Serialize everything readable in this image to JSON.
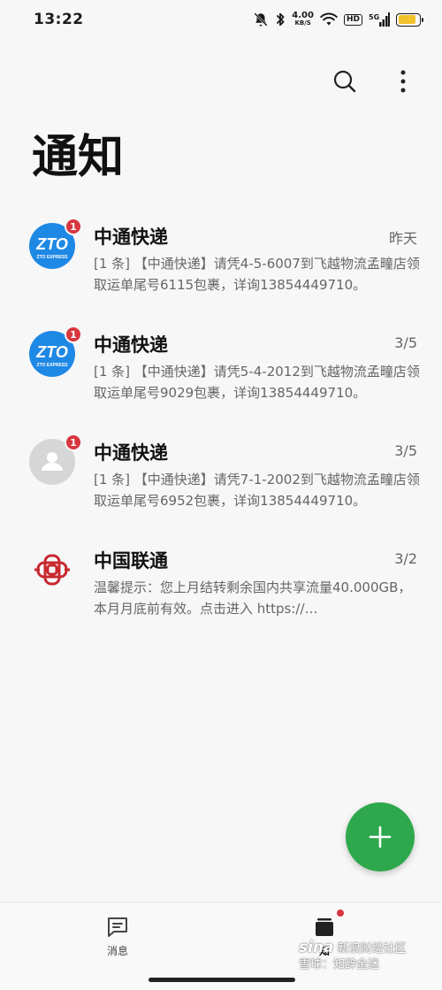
{
  "status_bar": {
    "time": "13:22",
    "net_speed": "4.00",
    "net_unit": "KB/S",
    "hd": "HD",
    "signal": "5G",
    "battery_level": 0.85,
    "battery_color": "#f2c22a"
  },
  "toolbar": {
    "search_icon": "search-icon",
    "more_icon": "more-vertical-icon"
  },
  "page": {
    "title": "通知"
  },
  "messages": [
    {
      "sender": "中通快递",
      "date": "昨天",
      "preview": "[1 条] 【中通快递】请凭4-5-6007到飞越物流孟疃店领取运单尾号6115包裹，详询13854449710。",
      "avatar": "zto-logo",
      "badge": "1"
    },
    {
      "sender": "中通快递",
      "date": "3/5",
      "preview": "[1 条] 【中通快递】请凭5-4-2012到飞越物流孟疃店领取运单尾号9029包裹，详询13854449710。",
      "avatar": "zto-logo",
      "badge": "1"
    },
    {
      "sender": "中通快递",
      "date": "3/5",
      "preview": "[1 条] 【中通快递】请凭7-1-2002到飞越物流孟疃店领取运单尾号6952包裹，详询13854449710。",
      "avatar": "person-placeholder",
      "badge": "1"
    },
    {
      "sender": "中国联通",
      "date": "3/2",
      "preview": "温馨提示：您上月结转剩余国内共享流量40.000GB， 本月月底前有效。点击进入 https://…",
      "avatar": "china-unicom-logo",
      "badge": ""
    }
  ],
  "zto_logo_text": "ZTO",
  "zto_logo_sub": "ZTO EXPRESS",
  "fab": {
    "icon": "plus-icon",
    "color": "#2ea84c"
  },
  "bottom_nav": {
    "messages_label": "消息",
    "notifications_label": "知"
  },
  "watermark": {
    "brand": "sina",
    "line1": "新浪财经社区",
    "line2": "雪球：知辞金迷"
  },
  "colors": {
    "badge": "#d9363e",
    "zto_blue": "#1e88e5",
    "unicom_red": "#c8282e"
  }
}
